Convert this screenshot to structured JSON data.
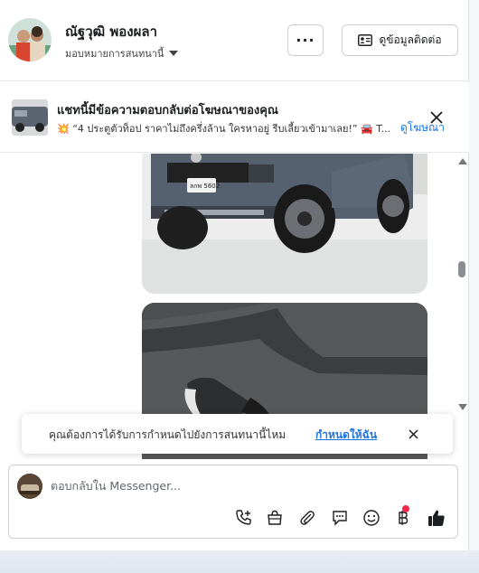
{
  "header": {
    "name": "ณัฐวุฒิ พองผลา",
    "assign_label": "มอบหมายการสนทนานี้",
    "more_label": "···",
    "contact_label": "ดูข้อมูลติดต่อ"
  },
  "ad_banner": {
    "title": "แชทนี้มีข้อความตอบกลับต่อโฆษณาของคุณ",
    "subtitle": "💥 “4 ประตูตัวท็อป ราคาไม่ถึงครึ่งล้าน ใครหาอยู่ รีบเลี้ยวเข้ามาเลย!” 🚘 T...",
    "link_label": "ดูโฆษณา"
  },
  "chat": {
    "plate_text": "ลกพ 5602"
  },
  "toast": {
    "text": "คุณต้องการได้รับการกำหนดไปยังการสนทนานี้ไหม",
    "link": "กำหนดให้ฉัน"
  },
  "composer": {
    "placeholder": "ตอบกลับใน Messenger...",
    "tools": [
      "phone-plus-icon",
      "shopping-bag-icon",
      "paperclip-icon",
      "chat-bubble-icon",
      "smiley-icon",
      "baht-icon",
      "thumbs-up-icon"
    ]
  },
  "colors": {
    "accent": "#1b74e4",
    "notification": "#f02849",
    "border": "#ccd0d5"
  }
}
